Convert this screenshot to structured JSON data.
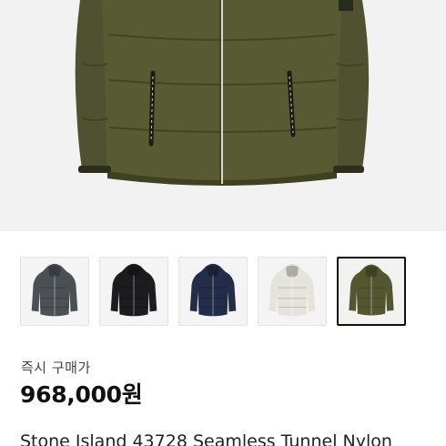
{
  "hero": {
    "image": "olive-green-puffer-jacket-front",
    "colors": {
      "jacket": "#545630",
      "background": "#f2f2f2"
    }
  },
  "thumbnails": [
    {
      "color_name": "charcoal",
      "color": "#4b5055",
      "selected": false
    },
    {
      "color_name": "black",
      "color": "#1c1c1e",
      "selected": false
    },
    {
      "color_name": "navy",
      "color": "#232c48",
      "selected": false
    },
    {
      "color_name": "off-white",
      "color": "#e4e3dc",
      "selected": false
    },
    {
      "color_name": "olive",
      "color": "#545630",
      "selected": true
    }
  ],
  "purchase": {
    "label": "즉시 구매가",
    "price": "968,000원"
  },
  "product": {
    "title": "Stone Island 43728 Seamless Tunnel Nylon"
  }
}
